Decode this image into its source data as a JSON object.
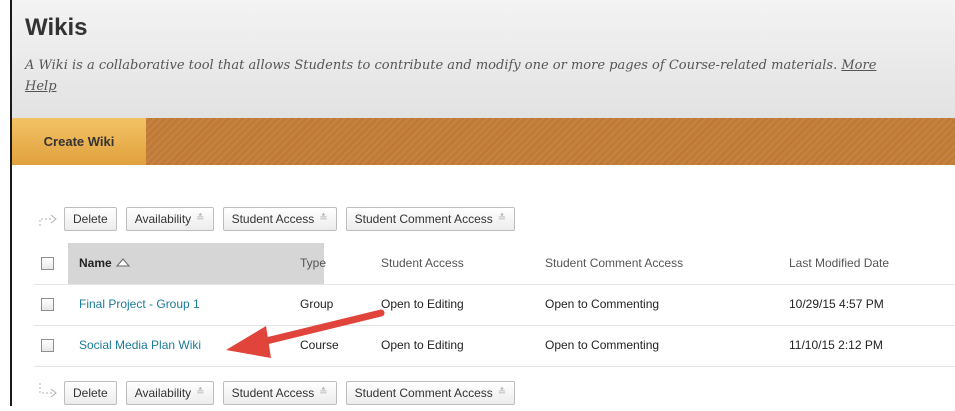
{
  "header": {
    "title": "Wikis",
    "description": "A Wiki is a collaborative tool that allows Students to contribute and modify one or more pages of Course-related materials.",
    "more_link": "More",
    "help_link": "Help"
  },
  "action_bar": {
    "create_label": "Create Wiki"
  },
  "toolbar": {
    "delete": "Delete",
    "availability": "Availability",
    "student_access": "Student Access",
    "student_comment_access": "Student Comment Access"
  },
  "table": {
    "columns": [
      "Name",
      "Type",
      "Student Access",
      "Student Comment Access",
      "Last Modified Date"
    ],
    "rows": [
      {
        "name": "Final Project - Group 1",
        "type": "Group",
        "student_access": "Open to Editing",
        "comment_access": "Open to Commenting",
        "modified": "10/29/15 4:57 PM"
      },
      {
        "name": "Social Media Plan Wiki",
        "type": "Course",
        "student_access": "Open to Editing",
        "comment_access": "Open to Commenting",
        "modified": "11/10/15 2:12 PM"
      }
    ]
  },
  "colors": {
    "action_bar": "#c07a36",
    "create_button": "#e8ad4a",
    "link": "#1c7a9a",
    "annotation_arrow": "#e0443a"
  },
  "icons": {
    "sort": "sort-ascending-icon",
    "chevron": "double-chevron-down-icon",
    "annotation": "red-arrow-annotation"
  }
}
